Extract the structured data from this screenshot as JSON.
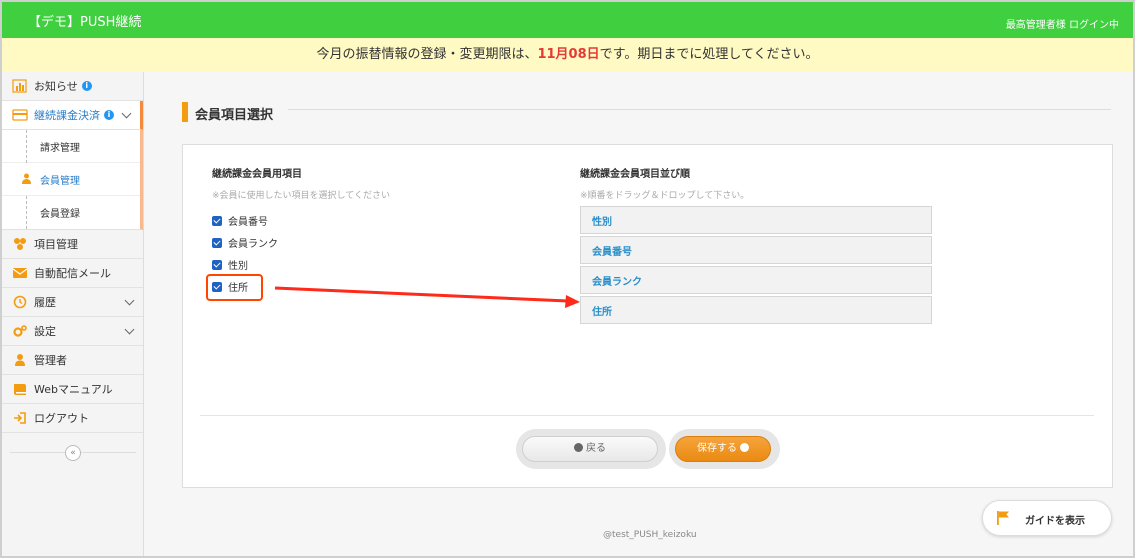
{
  "header": {
    "app_title": "【デモ】PUSH継続",
    "login_status": "最高管理者様 ログイン中"
  },
  "notice": {
    "prefix": "今月の振替情報の登録・変更期限は、",
    "deadline": "11月08日",
    "suffix": "です。期日までに処理してください。",
    "deadline_color": "#e53935"
  },
  "sidebar": {
    "items": [
      {
        "label": "お知らせ",
        "icon": "bar-chart-icon",
        "info": "i"
      },
      {
        "label": "継続課金決済",
        "icon": "card-icon",
        "info": "i"
      },
      {
        "label": "項目管理",
        "icon": "items-icon"
      },
      {
        "label": "自動配信メール",
        "icon": "mail-icon"
      },
      {
        "label": "履歴",
        "icon": "history-icon"
      },
      {
        "label": "設定",
        "icon": "gears-icon"
      },
      {
        "label": "管理者",
        "icon": "person-icon"
      },
      {
        "label": "Webマニュアル",
        "icon": "book-icon"
      },
      {
        "label": "ログアウト",
        "icon": "logout-icon"
      }
    ],
    "subitems": [
      {
        "label": "請求管理"
      },
      {
        "label": "会員管理"
      },
      {
        "label": "会員登録"
      }
    ],
    "collapse": "«"
  },
  "main": {
    "section_title": "会員項目選択",
    "left": {
      "heading": "継続課金会員用項目",
      "hint": "※会員に使用したい項目を選択してください",
      "checkboxes": [
        {
          "label": "会員番号",
          "checked": true
        },
        {
          "label": "会員ランク",
          "checked": true
        },
        {
          "label": "性別",
          "checked": true
        },
        {
          "label": "住所",
          "checked": true
        }
      ]
    },
    "right": {
      "heading": "継続課金会員項目並び順",
      "hint": "※順番をドラッグ＆ドロップして下さい。",
      "order": [
        {
          "label": "性別"
        },
        {
          "label": "会員番号"
        },
        {
          "label": "会員ランク"
        },
        {
          "label": "住所"
        }
      ]
    },
    "buttons": {
      "back": "戻る",
      "save": "保存する"
    },
    "footer": "@test_PUSH_keizoku",
    "guide": "ガイドを表示"
  },
  "colors": {
    "header_green": "#3fcf3f",
    "accent_orange": "#f39c12",
    "link_blue": "#2a8fc9",
    "annotation_red": "#ff3b1f"
  }
}
